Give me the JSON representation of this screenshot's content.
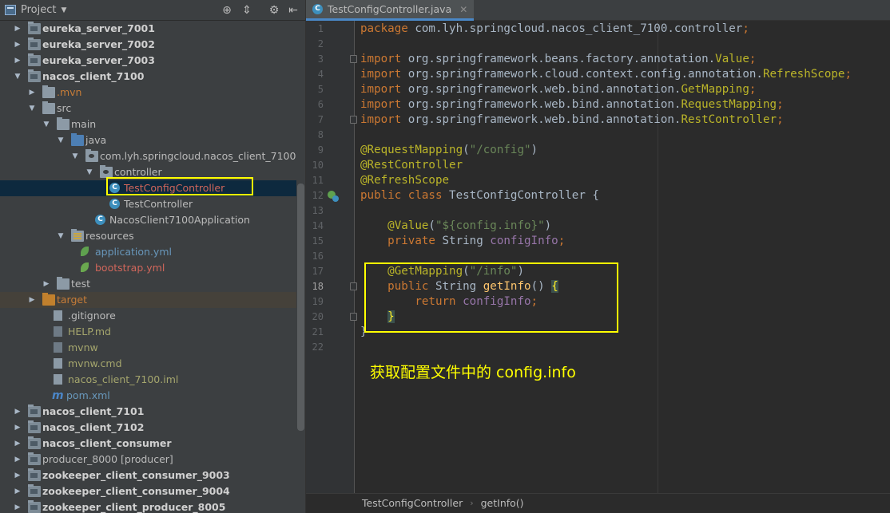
{
  "project_panel": {
    "title": "Project",
    "tree": [
      {
        "label": "eureka_server_7001",
        "style": "bold-d",
        "arrow": "▶",
        "icon": "folder-mod",
        "indent": 0
      },
      {
        "label": "eureka_server_7002",
        "style": "bold-d",
        "arrow": "▶",
        "icon": "folder-mod",
        "indent": 0
      },
      {
        "label": "eureka_server_7003",
        "style": "bold-d",
        "arrow": "▶",
        "icon": "folder-mod",
        "indent": 0
      },
      {
        "label": "nacos_client_7100",
        "style": "bold-d",
        "arrow": "▼",
        "icon": "folder-mod",
        "indent": 0
      },
      {
        "label": ".mvn",
        "style": "excluded",
        "arrow": "▶",
        "icon": "folder",
        "indent": 1
      },
      {
        "label": "src",
        "style": "default",
        "arrow": "▼",
        "icon": "folder",
        "indent": 1
      },
      {
        "label": "main",
        "style": "default",
        "arrow": "▼",
        "icon": "folder",
        "indent": 2
      },
      {
        "label": "java",
        "style": "default",
        "arrow": "▼",
        "icon": "folder-blue",
        "indent": 3
      },
      {
        "label": "com.lyh.springcloud.nacos_client_7100",
        "style": "default",
        "arrow": "▼",
        "icon": "folder-pkg",
        "indent": 4
      },
      {
        "label": "controller",
        "style": "default",
        "arrow": "▼",
        "icon": "folder-pkg",
        "indent": 5
      },
      {
        "label": "TestConfigController",
        "style": "yml-red",
        "arrow": "",
        "icon": "class",
        "indent": 6,
        "selected": true
      },
      {
        "label": "TestController",
        "style": "default",
        "arrow": "",
        "icon": "class",
        "indent": 6
      },
      {
        "label": "NacosClient7100Application",
        "style": "default",
        "arrow": "",
        "icon": "class",
        "indent": 5
      },
      {
        "label": "resources",
        "style": "default",
        "arrow": "▼",
        "icon": "folder-res",
        "indent": 3
      },
      {
        "label": "application.yml",
        "style": "yml-blue",
        "arrow": "",
        "icon": "leaf",
        "indent": 4
      },
      {
        "label": "bootstrap.yml",
        "style": "yml-red",
        "arrow": "",
        "icon": "leaf",
        "indent": 4
      },
      {
        "label": "test",
        "style": "default",
        "arrow": "▶",
        "icon": "folder",
        "indent": 2
      },
      {
        "label": "target",
        "style": "excluded",
        "arrow": "▶",
        "icon": "folder-orange",
        "indent": 1,
        "shaded": true
      },
      {
        "label": ".gitignore",
        "style": "default",
        "arrow": "",
        "icon": "file",
        "indent": 2
      },
      {
        "label": "HELP.md",
        "style": "modified",
        "arrow": "",
        "icon": "file-dark",
        "indent": 2
      },
      {
        "label": "mvnw",
        "style": "modified",
        "arrow": "",
        "icon": "file-dark",
        "indent": 2
      },
      {
        "label": "mvnw.cmd",
        "style": "modified",
        "arrow": "",
        "icon": "file",
        "indent": 2
      },
      {
        "label": "nacos_client_7100.iml",
        "style": "modified",
        "arrow": "",
        "icon": "file",
        "indent": 2
      },
      {
        "label": "pom.xml",
        "style": "yml-blue",
        "arrow": "",
        "icon": "maven",
        "indent": 2
      },
      {
        "label": "nacos_client_7101",
        "style": "bold-d",
        "arrow": "▶",
        "icon": "folder-mod",
        "indent": 0
      },
      {
        "label": "nacos_client_7102",
        "style": "bold-d",
        "arrow": "▶",
        "icon": "folder-mod",
        "indent": 0
      },
      {
        "label": "nacos_client_consumer",
        "style": "bold-d",
        "arrow": "▶",
        "icon": "folder-mod",
        "indent": 0
      },
      {
        "label": "producer_8000 [producer]",
        "style": "default",
        "arrow": "▶",
        "icon": "folder-mod",
        "indent": 0
      },
      {
        "label": "zookeeper_client_consumer_9003",
        "style": "bold-d",
        "arrow": "▶",
        "icon": "folder-mod",
        "indent": 0
      },
      {
        "label": "zookeeper_client_consumer_9004",
        "style": "bold-d",
        "arrow": "▶",
        "icon": "folder-mod",
        "indent": 0
      },
      {
        "label": "zookeeper_client_producer_8005",
        "style": "bold-d",
        "arrow": "▶",
        "icon": "folder-mod",
        "indent": 0
      }
    ]
  },
  "editor": {
    "tab_label": "TestConfigController.java",
    "line_numbers": [
      "1",
      "2",
      "3",
      "4",
      "5",
      "6",
      "7",
      "8",
      "9",
      "10",
      "11",
      "12",
      "13",
      "14",
      "15",
      "16",
      "17",
      "18",
      "19",
      "20",
      "21",
      "22"
    ],
    "current_line": "18",
    "code_lines": [
      [
        {
          "t": "package ",
          "c": "kw"
        },
        {
          "t": "com.lyh.springcloud.nacos_client_7100.controller",
          "c": ""
        },
        {
          "t": ";",
          "c": "kw"
        }
      ],
      [],
      [
        {
          "t": "import ",
          "c": "kw"
        },
        {
          "t": "org.springframework.beans.factory.annotation.",
          "c": ""
        },
        {
          "t": "Value",
          "c": "an"
        },
        {
          "t": ";",
          "c": "kw"
        }
      ],
      [
        {
          "t": "import ",
          "c": "kw"
        },
        {
          "t": "org.springframework.cloud.context.config.annotation.",
          "c": ""
        },
        {
          "t": "RefreshScope",
          "c": "an"
        },
        {
          "t": ";",
          "c": "kw"
        }
      ],
      [
        {
          "t": "import ",
          "c": "kw"
        },
        {
          "t": "org.springframework.web.bind.annotation.",
          "c": ""
        },
        {
          "t": "GetMapping",
          "c": "an"
        },
        {
          "t": ";",
          "c": "kw"
        }
      ],
      [
        {
          "t": "import ",
          "c": "kw"
        },
        {
          "t": "org.springframework.web.bind.annotation.",
          "c": ""
        },
        {
          "t": "RequestMapping",
          "c": "an"
        },
        {
          "t": ";",
          "c": "kw"
        }
      ],
      [
        {
          "t": "import ",
          "c": "kw"
        },
        {
          "t": "org.springframework.web.bind.annotation.",
          "c": ""
        },
        {
          "t": "RestController",
          "c": "an"
        },
        {
          "t": ";",
          "c": "kw"
        }
      ],
      [],
      [
        {
          "t": "@RequestMapping",
          "c": "an"
        },
        {
          "t": "(",
          "c": ""
        },
        {
          "t": "\"/config\"",
          "c": "str"
        },
        {
          "t": ")",
          "c": ""
        }
      ],
      [
        {
          "t": "@RestController",
          "c": "an"
        }
      ],
      [
        {
          "t": "@RefreshScope",
          "c": "an"
        }
      ],
      [
        {
          "t": "public class ",
          "c": "kw"
        },
        {
          "t": "TestConfigController {",
          "c": ""
        }
      ],
      [],
      [
        {
          "t": "    @Value",
          "c": "an"
        },
        {
          "t": "(",
          "c": ""
        },
        {
          "t": "\"${config.info}\"",
          "c": "str"
        },
        {
          "t": ")",
          "c": ""
        }
      ],
      [
        {
          "t": "    private ",
          "c": "kw"
        },
        {
          "t": "String ",
          "c": ""
        },
        {
          "t": "configInfo",
          "c": "fld"
        },
        {
          "t": ";",
          "c": "kw"
        }
      ],
      [],
      [
        {
          "t": "    @GetMapping",
          "c": "an"
        },
        {
          "t": "(",
          "c": ""
        },
        {
          "t": "\"/info\"",
          "c": "str"
        },
        {
          "t": ")",
          "c": ""
        }
      ],
      [
        {
          "t": "    public ",
          "c": "kw"
        },
        {
          "t": "String ",
          "c": ""
        },
        {
          "t": "getInfo",
          "c": "fn"
        },
        {
          "t": "() ",
          "c": ""
        },
        {
          "t": "{",
          "c": "brace-hl"
        }
      ],
      [
        {
          "t": "        return ",
          "c": "kw"
        },
        {
          "t": "configInfo",
          "c": "fld"
        },
        {
          "t": ";",
          "c": "kw"
        }
      ],
      [
        {
          "t": "    ",
          "c": ""
        },
        {
          "t": "}",
          "c": "brace-hl"
        }
      ],
      [
        {
          "t": "}",
          "c": ""
        }
      ],
      []
    ]
  },
  "annotation_text": "获取配置文件中的 config.info",
  "breadcrumb": [
    "TestConfigController",
    "getInfo()"
  ],
  "colors": {
    "highlight_box": "#ffff00",
    "selection": "#0d293e",
    "tab_underline": "#4a88c7"
  }
}
